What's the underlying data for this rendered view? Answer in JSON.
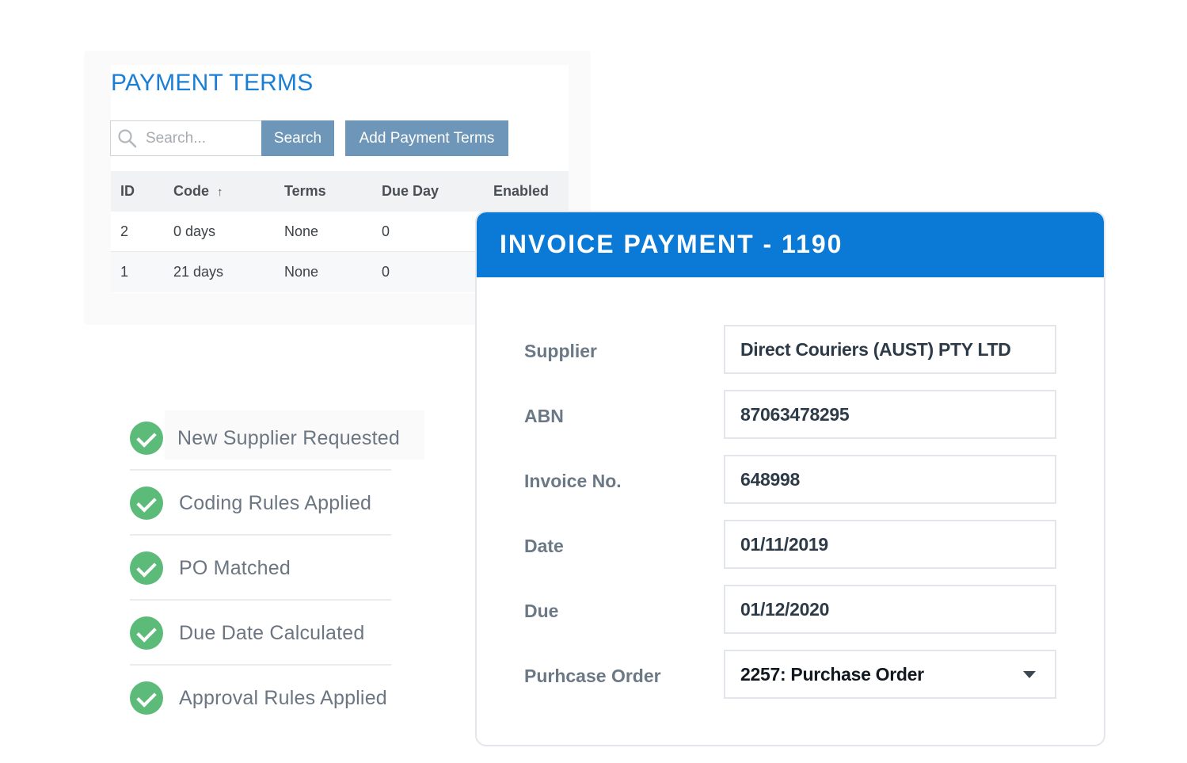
{
  "payment_terms": {
    "title": "PAYMENT TERMS",
    "search": {
      "placeholder": "Search...",
      "button_label": "Search"
    },
    "add_button_label": "Add Payment Terms",
    "table": {
      "columns": [
        "ID",
        "Code",
        "Terms",
        "Due Day",
        "Enabled"
      ],
      "sort_column": "Code",
      "rows": [
        {
          "id": "2",
          "code": "0 days",
          "terms": "None",
          "due_day": "0"
        },
        {
          "id": "1",
          "code": "21 days",
          "terms": "None",
          "due_day": "0"
        }
      ]
    }
  },
  "checklist": {
    "items": [
      "New Supplier Requested",
      "Coding Rules Applied",
      "PO Matched",
      "Due Date Calculated",
      "Approval Rules Applied"
    ],
    "icon": "check-circle-icon",
    "icon_color": "#5dbb7a"
  },
  "invoice_payment": {
    "title": "INVOICE PAYMENT - 1190",
    "header_color": "#0b7ad6",
    "fields": [
      {
        "label": "Supplier",
        "value": "Direct Couriers (AUST) PTY LTD"
      },
      {
        "label": "ABN",
        "value": "87063478295"
      },
      {
        "label": "Invoice No.",
        "value": "648998"
      },
      {
        "label": "Date",
        "value": "01/11/2019"
      },
      {
        "label": "Due",
        "value": "01/12/2020"
      },
      {
        "label": "Purhcase Order",
        "value": "2257: Purchase Order"
      }
    ]
  }
}
